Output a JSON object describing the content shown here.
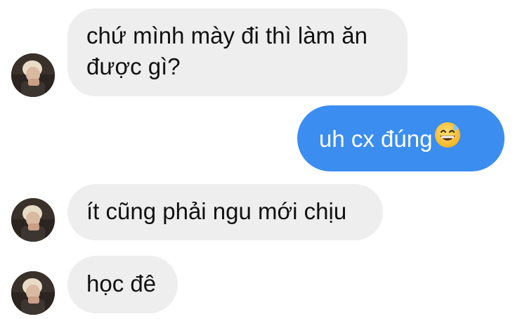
{
  "conversation": {
    "messages": [
      {
        "direction": "incoming",
        "lines": [
          "chứ mình mày đi thì làm ăn",
          "được gì?"
        ]
      },
      {
        "direction": "outgoing",
        "text": "uh cx đúng",
        "emoji": "grinning-sweat-emoji"
      },
      {
        "direction": "incoming",
        "text": "ít cũng phải ngu mới chịu"
      },
      {
        "direction": "incoming",
        "text": "học đê"
      }
    ]
  },
  "colors": {
    "incoming_bubble": "#eeeeef",
    "outgoing_bubble": "#3b8df0",
    "incoming_text": "#111111",
    "outgoing_text": "#ffffff",
    "background": "#ffffff"
  }
}
